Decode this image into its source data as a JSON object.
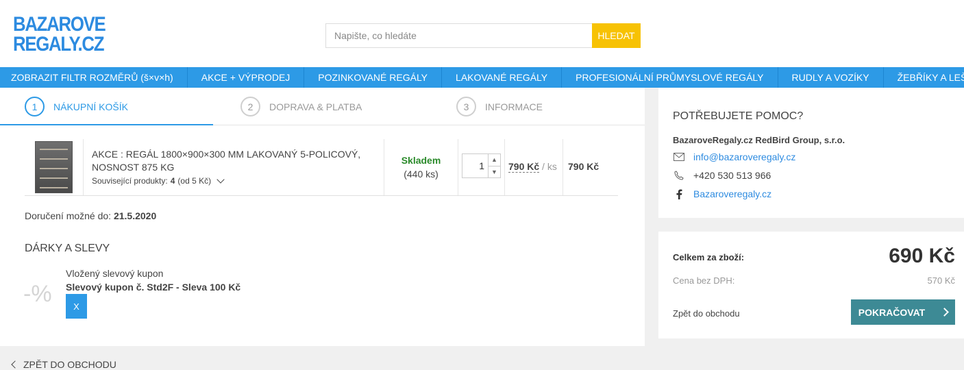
{
  "header": {
    "logo_line1": "BAZAROVE",
    "logo_line2": "REGALY.CZ",
    "search_placeholder": "Napište, co hledáte",
    "search_button": "HLEDAT"
  },
  "nav": [
    "ZOBRAZIT FILTR ROZMĚRŮ (š×v×h)",
    "AKCE + VÝPRODEJ",
    "POZINKOVANÉ REGÁLY",
    "LAKOVANÉ REGÁLY",
    "PROFESIONÁLNÍ PRŮMYSLOVÉ REGÁLY",
    "RUDLY A VOZÍKY",
    "ŽEBŘÍKY A LEŠENÍ"
  ],
  "steps": [
    {
      "num": "1",
      "label": "NÁKUPNÍ KOŠÍK"
    },
    {
      "num": "2",
      "label": "DOPRAVA & PLATBA"
    },
    {
      "num": "3",
      "label": "INFORMACE"
    }
  ],
  "cart_item": {
    "name_line1": "AKCE : REGÁL 1800×900×300 MM LAKOVANÝ 5-POLICOVÝ,",
    "name_line2": "NOSNOST 875 KG",
    "related_label": "Související produkty:",
    "related_count": "4",
    "related_suffix": "(od 5 Kč)",
    "stock_label": "Skladem",
    "stock_count": "(440 ks)",
    "quantity": "1",
    "unit_price": "790 Kč",
    "unit_suffix": "/ ks",
    "total_price": "790 Kč"
  },
  "delivery": {
    "label": "Doručení možné do:",
    "date": "21.5.2020"
  },
  "gifts": {
    "title": "DÁRKY A SLEVY",
    "percent_symbol": "-%",
    "coupon_label": "Vložený slevový kupon",
    "coupon_name": "Slevový kupon č. Std2F - Sleva 100 Kč",
    "remove": "X"
  },
  "back_link": "ZPĚT DO OBCHODU",
  "help": {
    "title": "POTŘEBUJETE POMOC?",
    "company": "BazaroveRegaly.cz RedBird Group, s.r.o.",
    "email": "info@bazaroveregaly.cz",
    "phone": "+420 530 513 966",
    "facebook": "Bazaroveregaly.cz"
  },
  "summary": {
    "total_label": "Celkem za zboží:",
    "total_price": "690 Kč",
    "vat_label": "Cena bez DPH:",
    "vat_price": "570 Kč",
    "back": "Zpět do obchodu",
    "continue": "POKRAČOVAT"
  },
  "colors": {
    "brand_blue": "#2d9ae6",
    "search_yellow": "#f7c204",
    "continue_teal": "#3d8a95",
    "stock_green": "#2a8a2a"
  }
}
